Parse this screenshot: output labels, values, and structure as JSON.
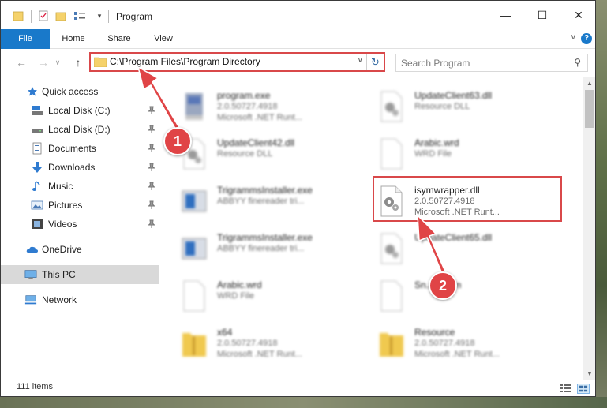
{
  "window": {
    "title": "Program",
    "minimize_label": "—",
    "maximize_label": "☐",
    "close_label": "✕"
  },
  "ribbon": {
    "tabs": [
      "File",
      "Home",
      "Share",
      "View"
    ],
    "help": "?"
  },
  "nav": {
    "address": "C:\\Program Files\\Program Directory",
    "search_placeholder": "Search Program"
  },
  "sidebar": {
    "items": [
      {
        "label": "Quick access",
        "icon": "star-icon"
      },
      {
        "label": "Local Disk (C:)",
        "icon": "drive-icon"
      },
      {
        "label": "Local Disk (D:)",
        "icon": "drive-icon"
      },
      {
        "label": "Documents",
        "icon": "documents-icon"
      },
      {
        "label": "Downloads",
        "icon": "download-icon"
      },
      {
        "label": "Music",
        "icon": "music-icon"
      },
      {
        "label": "Pictures",
        "icon": "pictures-icon"
      },
      {
        "label": "Videos",
        "icon": "videos-icon"
      },
      {
        "label": "OneDrive",
        "icon": "cloud-icon"
      },
      {
        "label": "This PC",
        "icon": "computer-icon"
      },
      {
        "label": "Network",
        "icon": "network-icon"
      }
    ]
  },
  "files": [
    {
      "name": "program.exe",
      "line2": "2.0.50727.4918",
      "line3": "Microsoft .NET Runt...",
      "icon": "exe-icon"
    },
    {
      "name": "UpdateClient63.dll",
      "line2": "Resource DLL",
      "line3": "",
      "icon": "dll-icon"
    },
    {
      "name": "UpdateClient42.dll",
      "line2": "Resource DLL",
      "line3": "",
      "icon": "dll-icon"
    },
    {
      "name": "Arabic.wrd",
      "line2": "WRD File",
      "line3": "",
      "icon": "blank-file-icon"
    },
    {
      "name": "TrigrammsInstaller.exe",
      "line2": "ABBYY finereader tri...",
      "line3": "",
      "icon": "installer-icon"
    },
    {
      "name": "isymwrapper.dll",
      "line2": "2.0.50727.4918",
      "line3": "Microsoft .NET Runt...",
      "icon": "dll-icon"
    },
    {
      "name": "TrigrammsInstaller.exe",
      "line2": "ABBYY finereader tri...",
      "line3": "",
      "icon": "installer-icon"
    },
    {
      "name": "UpdateClient65.dll",
      "line2": "",
      "line3": "",
      "icon": "dll-icon"
    },
    {
      "name": "Arabic.wrd",
      "line2": "WRD File",
      "line3": "",
      "icon": "blank-file-icon"
    },
    {
      "name": "Sn...2.wcm",
      "line2": "",
      "line3": "",
      "icon": "blank-file-icon"
    },
    {
      "name": "x64",
      "line2": "2.0.50727.4918",
      "line3": "Microsoft .NET Runt...",
      "icon": "zip-folder-icon"
    },
    {
      "name": "Resource",
      "line2": "2.0.50727.4918",
      "line3": "Microsoft .NET Runt...",
      "icon": "zip-folder-icon"
    }
  ],
  "status": {
    "count": "111 items"
  },
  "annotations": {
    "step1": "1",
    "step2": "2",
    "color": "#d9484a"
  },
  "colors": {
    "accent": "#1979ca",
    "highlight": "#d9484a"
  }
}
